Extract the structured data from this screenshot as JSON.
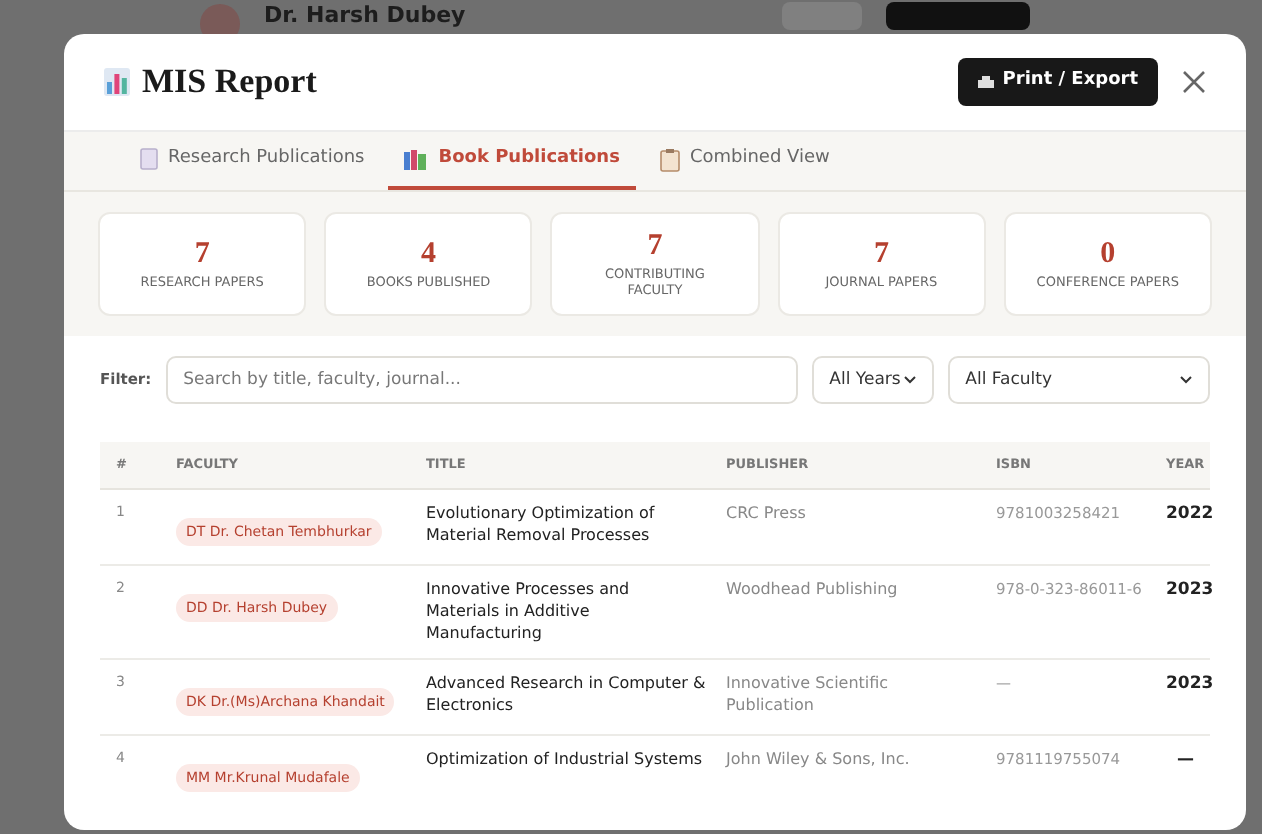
{
  "background": {
    "name": "Dr. Harsh Dubey"
  },
  "dialog": {
    "title": "MIS Report",
    "export_button": "Print / Export"
  },
  "tabs": [
    {
      "label": "Research Publications",
      "kind": "document",
      "selected": false
    },
    {
      "label": "Book Publications",
      "kind": "books",
      "selected": true
    },
    {
      "label": "Combined View",
      "kind": "clipboard",
      "selected": false
    }
  ],
  "stats": [
    {
      "value": "7",
      "label": "RESEARCH PAPERS"
    },
    {
      "value": "4",
      "label": "BOOKS PUBLISHED"
    },
    {
      "value": "7",
      "label": "CONTRIBUTING FACULTY"
    },
    {
      "value": "7",
      "label": "JOURNAL PAPERS"
    },
    {
      "value": "0",
      "label": "CONFERENCE PAPERS"
    }
  ],
  "filter": {
    "label": "Filter:",
    "placeholder": "Search by title, faculty, journal...",
    "year": "All Years",
    "faculty": "All Faculty"
  },
  "table": {
    "columns": [
      "#",
      "FACULTY",
      "TITLE",
      "PUBLISHER",
      "ISBN",
      "YEAR"
    ],
    "rows": [
      {
        "number": "1",
        "faculty": "DT Dr. Chetan Tembhurkar",
        "title": "Evolutionary Optimization of Material Removal Processes",
        "publisher": "CRC Press",
        "isbn": "9781003258421",
        "year": "2022"
      },
      {
        "number": "2",
        "faculty": "DD Dr. Harsh Dubey",
        "title": "Innovative Processes and Materials in Additive Manufacturing",
        "publisher": "Woodhead Publishing",
        "isbn": "978-0-323-86011-6",
        "year": "2023"
      },
      {
        "number": "3",
        "faculty": "DK Dr.(Ms)Archana Khandait",
        "title": "Advanced Research in Computer & Electronics",
        "publisher": "Innovative Scientific Publication",
        "isbn": "—",
        "year": "2023"
      },
      {
        "number": "4",
        "faculty": "MM Mr.Krunal Mudafale",
        "title": "Optimization of Industrial Systems",
        "publisher": "John Wiley & Sons, Inc.",
        "isbn": "9781119755074",
        "year": "—"
      }
    ]
  }
}
